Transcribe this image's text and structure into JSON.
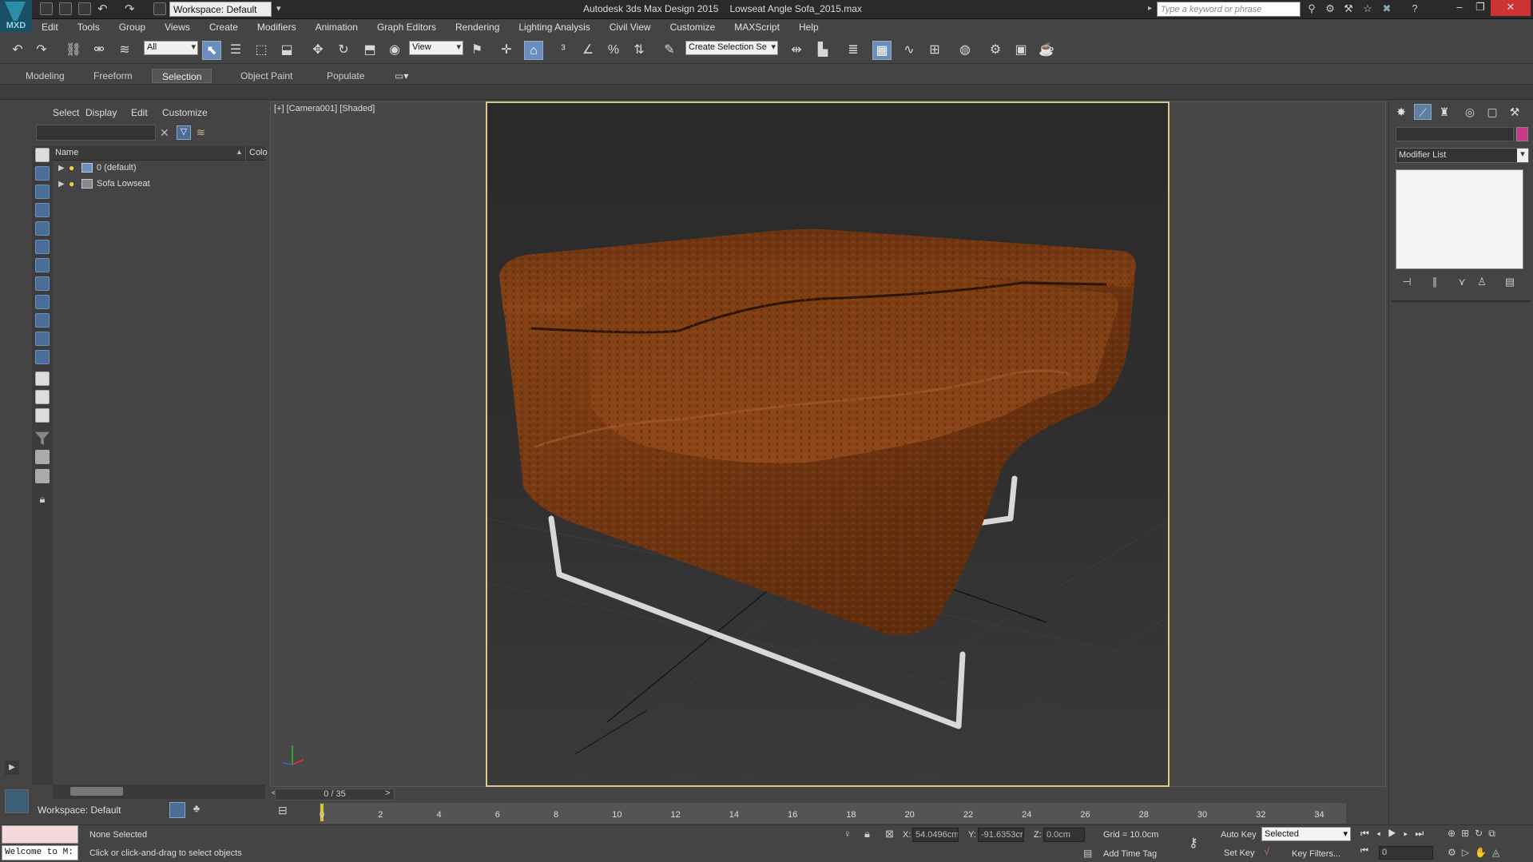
{
  "app": {
    "logo_text": "MXD",
    "workspace": "Workspace: Default",
    "title_app": "Autodesk 3ds Max Design 2015",
    "title_file": "Lowseat Angle Sofa_2015.max",
    "search_placeholder": "Type a keyword or phrase"
  },
  "menu": [
    "Edit",
    "Tools",
    "Group",
    "Views",
    "Create",
    "Modifiers",
    "Animation",
    "Graph Editors",
    "Rendering",
    "Lighting Analysis",
    "Civil View",
    "Customize",
    "MAXScript",
    "Help"
  ],
  "toolbar": {
    "selection_filter": "All",
    "ref_coord": "View",
    "named_selection": "Create Selection Se",
    "icons": [
      "undo-icon",
      "redo-icon",
      "select-link-icon",
      "unlink-icon",
      "bind-space-warp-icon",
      "select-object-icon",
      "select-by-name-icon",
      "rect-selection-region-icon",
      "window-crossing-icon",
      "select-move-icon",
      "select-rotate-icon",
      "select-scale-icon",
      "select-place-icon",
      "use-pivot-icon",
      "select-manipulate-icon",
      "keyboard-shortcut-toggle-icon",
      "snaps-toggle-icon",
      "angle-snap-icon",
      "percent-snap-icon",
      "spinner-snap-icon",
      "edit-named-selection-icon",
      "mirror-icon",
      "align-icon",
      "layer-explorer-icon",
      "scene-explorer-icon",
      "curve-editor-icon",
      "schematic-view-icon",
      "material-editor-icon",
      "render-setup-icon",
      "rendered-frame-icon",
      "render-production-icon"
    ]
  },
  "ribbon": {
    "tabs": [
      "Modeling",
      "Freeform",
      "Selection",
      "Object Paint",
      "Populate"
    ],
    "active": "Selection"
  },
  "scene_explorer": {
    "menu": [
      "Select",
      "Display",
      "Edit",
      "Customize"
    ],
    "columns": {
      "name": "Name",
      "color": "Colo"
    },
    "rows": [
      "0 (default)",
      "Sofa Lowseat"
    ],
    "workspace": "Workspace: Default"
  },
  "viewport": {
    "label": "[+] [Camera001] [Shaded]"
  },
  "timeline": {
    "slider": "0 / 35",
    "ticks": [
      "0",
      "2",
      "4",
      "6",
      "8",
      "10",
      "12",
      "14",
      "16",
      "18",
      "20",
      "22",
      "24",
      "26",
      "28",
      "30",
      "32",
      "34"
    ],
    "ticks_values": [
      0,
      2,
      4,
      6,
      8,
      10,
      12,
      14,
      16,
      18,
      20,
      22,
      24,
      26,
      28,
      30,
      32,
      34
    ],
    "range": [
      0,
      35
    ]
  },
  "status": {
    "welcome": "Welcome to M:",
    "selection": "None Selected",
    "prompt": "Click or click-and-drag to select objects",
    "x_label": "X:",
    "x_value": "54.0496cm",
    "y_label": "Y:",
    "y_value": "-91.6353cr",
    "z_label": "Z:",
    "z_value": "0.0cm",
    "grid": "Grid = 10.0cm",
    "add_time_tag": "Add Time Tag",
    "auto_key": "Auto Key",
    "set_key": "Set Key",
    "selected": "Selected",
    "key_filters": "Key Filters...",
    "frame": "0"
  },
  "command_panel": {
    "modifier_list": "Modifier List",
    "object_color": "#c83a86"
  },
  "colors": {
    "ui_bg": "#444444",
    "safe_frame": "#d6c98a",
    "leather": "#7a3a10",
    "accent": "#6a8dbf"
  }
}
